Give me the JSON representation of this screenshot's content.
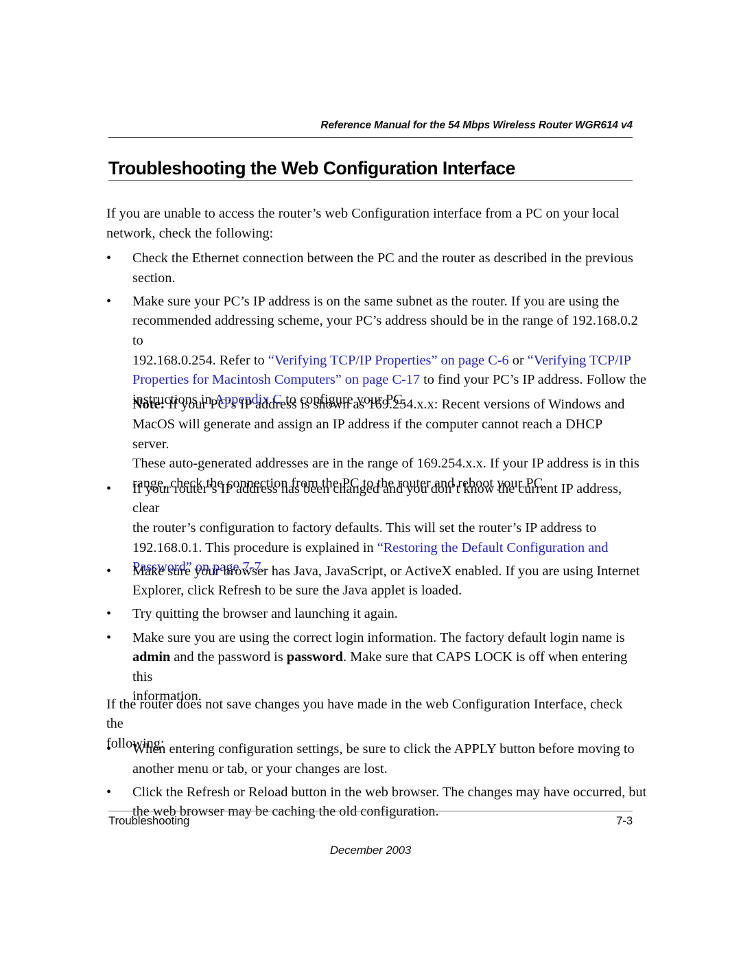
{
  "header": {
    "running_title": "Reference Manual for the 54 Mbps Wireless Router WGR614 v4"
  },
  "title": "Troubleshooting the Web Configuration Interface",
  "colors": {
    "link": "#2222cc",
    "text": "#0d0d0d",
    "rule": "#3a3a3a"
  },
  "intro_paragraph": {
    "line1": "If you are unable to access the router’s web Configuration interface from a PC on your local",
    "line2": "network, check the following:"
  },
  "bullets_group_1": [
    {
      "marker": "•",
      "lines": [
        {
          "runs": [
            {
              "text": "Check the Ethernet connection between the PC and the router as described in the previous",
              "style": "normal"
            }
          ]
        },
        {
          "runs": [
            {
              "text": "section.",
              "style": "normal"
            }
          ]
        }
      ]
    },
    {
      "marker": "•",
      "lines": [
        {
          "runs": [
            {
              "text": "Make sure your PC’s IP address is on the same subnet as the router. If you are using the",
              "style": "normal"
            }
          ]
        },
        {
          "runs": [
            {
              "text": "recommended addressing scheme, your PC’s address should be in the range of 192.168.0.2 to",
              "style": "normal"
            }
          ]
        },
        {
          "runs": [
            {
              "text": "192.168.0.254. Refer to ",
              "style": "normal"
            },
            {
              "text": "“Verifying TCP/IP Properties” on page C-6",
              "style": "link"
            },
            {
              "text": " or ",
              "style": "normal"
            },
            {
              "text": "“Verifying TCP/IP",
              "style": "link"
            }
          ]
        },
        {
          "runs": [
            {
              "text": "Properties for Macintosh Computers” on page C-17",
              "style": "link"
            },
            {
              "text": " to find your PC’s IP address. Follow the",
              "style": "normal"
            }
          ]
        },
        {
          "runs": [
            {
              "text": "instructions in ",
              "style": "normal"
            },
            {
              "text": "Appendix C",
              "style": "link"
            },
            {
              "text": " to configure your PC.",
              "style": "normal"
            }
          ]
        }
      ]
    }
  ],
  "note": {
    "label": "Note:",
    "lines": [
      {
        "runs": [
          {
            "text": "Note:",
            "style": "bold"
          },
          {
            "text": " If your PC’s IP address is shown as 169.254.x.x: Recent versions of Windows and",
            "style": "normal"
          }
        ]
      },
      {
        "runs": [
          {
            "text": "MacOS will generate and assign an IP address if the computer cannot reach a DHCP server.",
            "style": "normal"
          }
        ]
      },
      {
        "runs": [
          {
            "text": "These auto-generated addresses are in the range of 169.254.x.x. If your IP address is in this",
            "style": "normal"
          }
        ]
      },
      {
        "runs": [
          {
            "text": "range, check the connection from the PC to the router and reboot your PC.",
            "style": "normal"
          }
        ]
      }
    ]
  },
  "bullets_group_2": [
    {
      "marker": "•",
      "lines": [
        {
          "runs": [
            {
              "text": "If your router’s IP address has been changed and you don’t know the current IP address, clear",
              "style": "normal"
            }
          ]
        },
        {
          "runs": [
            {
              "text": "the router’s configuration to factory defaults. This will set the router’s IP address to",
              "style": "normal"
            }
          ]
        },
        {
          "runs": [
            {
              "text": "192.168.0.1. This procedure is explained in ",
              "style": "normal"
            },
            {
              "text": "“Restoring the Default Configuration and",
              "style": "link"
            }
          ]
        },
        {
          "runs": [
            {
              "text": "Password” on page 7-7",
              "style": "link"
            },
            {
              "text": ".",
              "style": "normal"
            }
          ]
        }
      ]
    },
    {
      "marker": "•",
      "lines": [
        {
          "runs": [
            {
              "text": "Make sure your browser has Java, JavaScript, or ActiveX enabled. If you are using Internet",
              "style": "normal"
            }
          ]
        },
        {
          "runs": [
            {
              "text": "Explorer, click Refresh to be sure the Java applet is loaded.",
              "style": "normal"
            }
          ]
        }
      ]
    },
    {
      "marker": "•",
      "lines": [
        {
          "runs": [
            {
              "text": "Try quitting the browser and launching it again.",
              "style": "normal"
            }
          ]
        }
      ]
    },
    {
      "marker": "•",
      "lines": [
        {
          "runs": [
            {
              "text": "Make sure you are using the correct login information. The factory default login name is",
              "style": "normal"
            }
          ]
        },
        {
          "runs": [
            {
              "text": "admin",
              "style": "bold"
            },
            {
              "text": " and the password is ",
              "style": "normal"
            },
            {
              "text": "password",
              "style": "bold"
            },
            {
              "text": ". Make sure that CAPS LOCK is off when entering this",
              "style": "normal"
            }
          ]
        },
        {
          "runs": [
            {
              "text": "information.",
              "style": "normal"
            }
          ]
        }
      ]
    }
  ],
  "second_paragraph": {
    "line1": "If the router does not save changes you have made in the web Configuration Interface, check the",
    "line2": "following:"
  },
  "bullets_group_3": [
    {
      "marker": "•",
      "lines": [
        {
          "runs": [
            {
              "text": "When entering configuration settings, be sure to click the APPLY button before moving to",
              "style": "normal"
            }
          ]
        },
        {
          "runs": [
            {
              "text": "another menu or tab, or your changes are lost.",
              "style": "normal"
            }
          ]
        }
      ]
    },
    {
      "marker": "•",
      "lines": [
        {
          "runs": [
            {
              "text": "Click the Refresh or Reload button in the web browser. The changes may have occurred, but",
              "style": "normal"
            }
          ]
        },
        {
          "runs": [
            {
              "text": "the web browser may be caching the old configuration.",
              "style": "normal"
            }
          ]
        }
      ]
    }
  ],
  "footer": {
    "left": "Troubleshooting",
    "page_number": "7-3",
    "date": "December 2003"
  }
}
